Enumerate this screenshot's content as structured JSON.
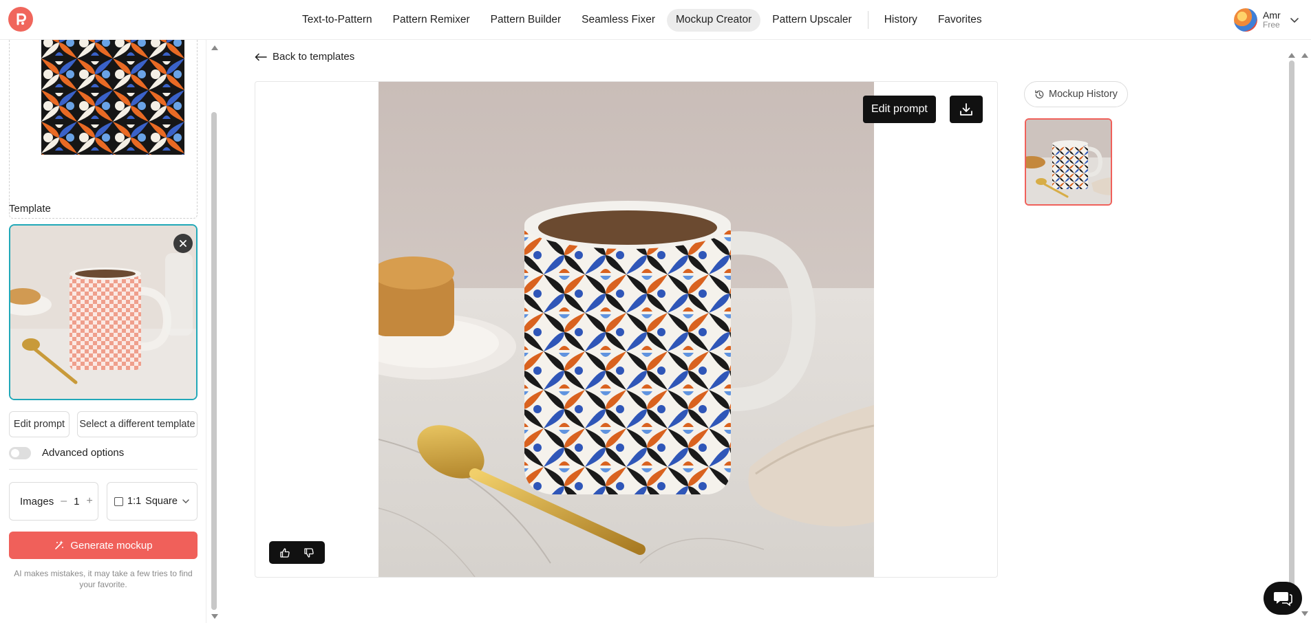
{
  "nav": {
    "items": [
      "Text-to-Pattern",
      "Pattern Remixer",
      "Pattern Builder",
      "Seamless Fixer",
      "Mockup Creator",
      "Pattern Upscaler"
    ],
    "active": "Mockup Creator",
    "secondary": [
      "History",
      "Favorites"
    ]
  },
  "user": {
    "name": "Amr",
    "plan": "Free"
  },
  "sidebar": {
    "template_label": "Template",
    "edit_prompt_label": "Edit prompt",
    "select_template_label": "Select a different template",
    "advanced_label": "Advanced options",
    "images_label": "Images",
    "images_count": "1",
    "ratio_value": "1:1",
    "ratio_name": "Square",
    "generate_label": "Generate mockup",
    "disclaimer": "AI makes mistakes, it may take a few tries to find your favorite."
  },
  "main": {
    "back_label": "Back to templates",
    "edit_prompt_label": "Edit prompt",
    "history_label": "Mockup History"
  },
  "colors": {
    "accent": "#f0605a",
    "selection": "#20a8b8",
    "dark": "#111111"
  }
}
